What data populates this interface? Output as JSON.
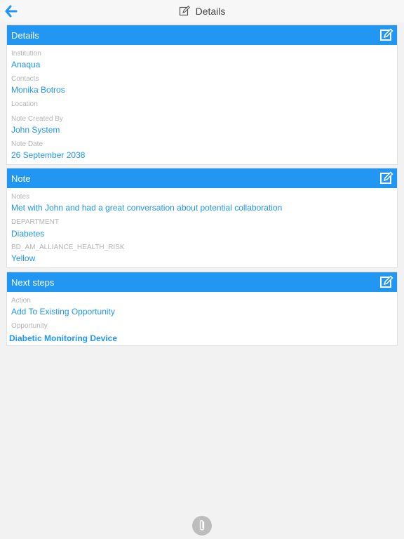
{
  "header": {
    "title": "Details"
  },
  "cards": {
    "details": {
      "title": "Details",
      "fields": [
        {
          "label": "Institution",
          "value": "Anaqua"
        },
        {
          "label": "Contacts",
          "value": "Monika Botros"
        },
        {
          "label": "Location",
          "value": ""
        },
        {
          "label": "Note Created By",
          "value": "John System"
        },
        {
          "label": "Note Date",
          "value": "26 September 2038"
        }
      ]
    },
    "note": {
      "title": "Note",
      "fields": [
        {
          "label": "Notes",
          "value": "Met with John and had a great conversation about potential collaboration"
        },
        {
          "label": "DEPARTMENT",
          "value": "Diabetes"
        },
        {
          "label": "BD_AM_ALLIANCE_HEALTH_RISK",
          "value": "Yellow"
        }
      ]
    },
    "next_steps": {
      "title": "Next steps",
      "fields": [
        {
          "label": "Action",
          "value": "Add To Existing Opportunity"
        },
        {
          "label": "Opportunity",
          "value": "Diabetic Monitoring Device"
        }
      ]
    }
  },
  "colors": {
    "accent": "#2196f3",
    "label": "#b5b5b5",
    "background": "#f2f2f2"
  },
  "icons": {
    "back": "arrow-left-icon",
    "title": "edit-icon",
    "edit": "edit-square-icon",
    "attach": "paperclip-icon"
  }
}
